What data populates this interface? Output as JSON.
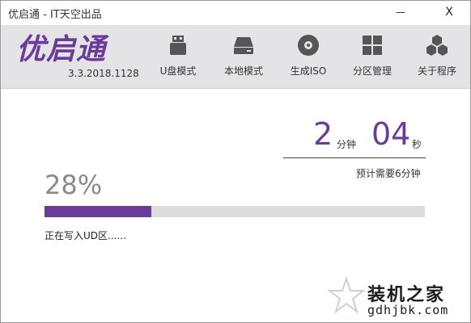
{
  "window": {
    "title": "优启通 - IT天空出品",
    "minimize_label": "",
    "close_label": "X"
  },
  "header": {
    "logo_text": "优启通",
    "version": "3.3.2018.1128",
    "nav": [
      {
        "label": "U盘模式",
        "icon": "usb-drive-icon"
      },
      {
        "label": "本地模式",
        "icon": "hard-disk-icon"
      },
      {
        "label": "生成ISO",
        "icon": "disc-icon"
      },
      {
        "label": "分区管理",
        "icon": "partition-grid-icon"
      },
      {
        "label": "关于程序",
        "icon": "hexagons-icon"
      }
    ]
  },
  "timer": {
    "minutes": "2",
    "minutes_unit": "分钟",
    "seconds": "04",
    "seconds_unit": "秒",
    "estimate": "预计需要6分钟"
  },
  "progress": {
    "percent_text": "28%",
    "value": 0.28,
    "status": "正在写入UD区......"
  },
  "watermark": {
    "main": "装机之家",
    "sub": "gdhjbk.com"
  },
  "colors": {
    "accent": "#6a3b99",
    "header_bg": "#e4e4e7",
    "track": "#dcdcdc"
  }
}
